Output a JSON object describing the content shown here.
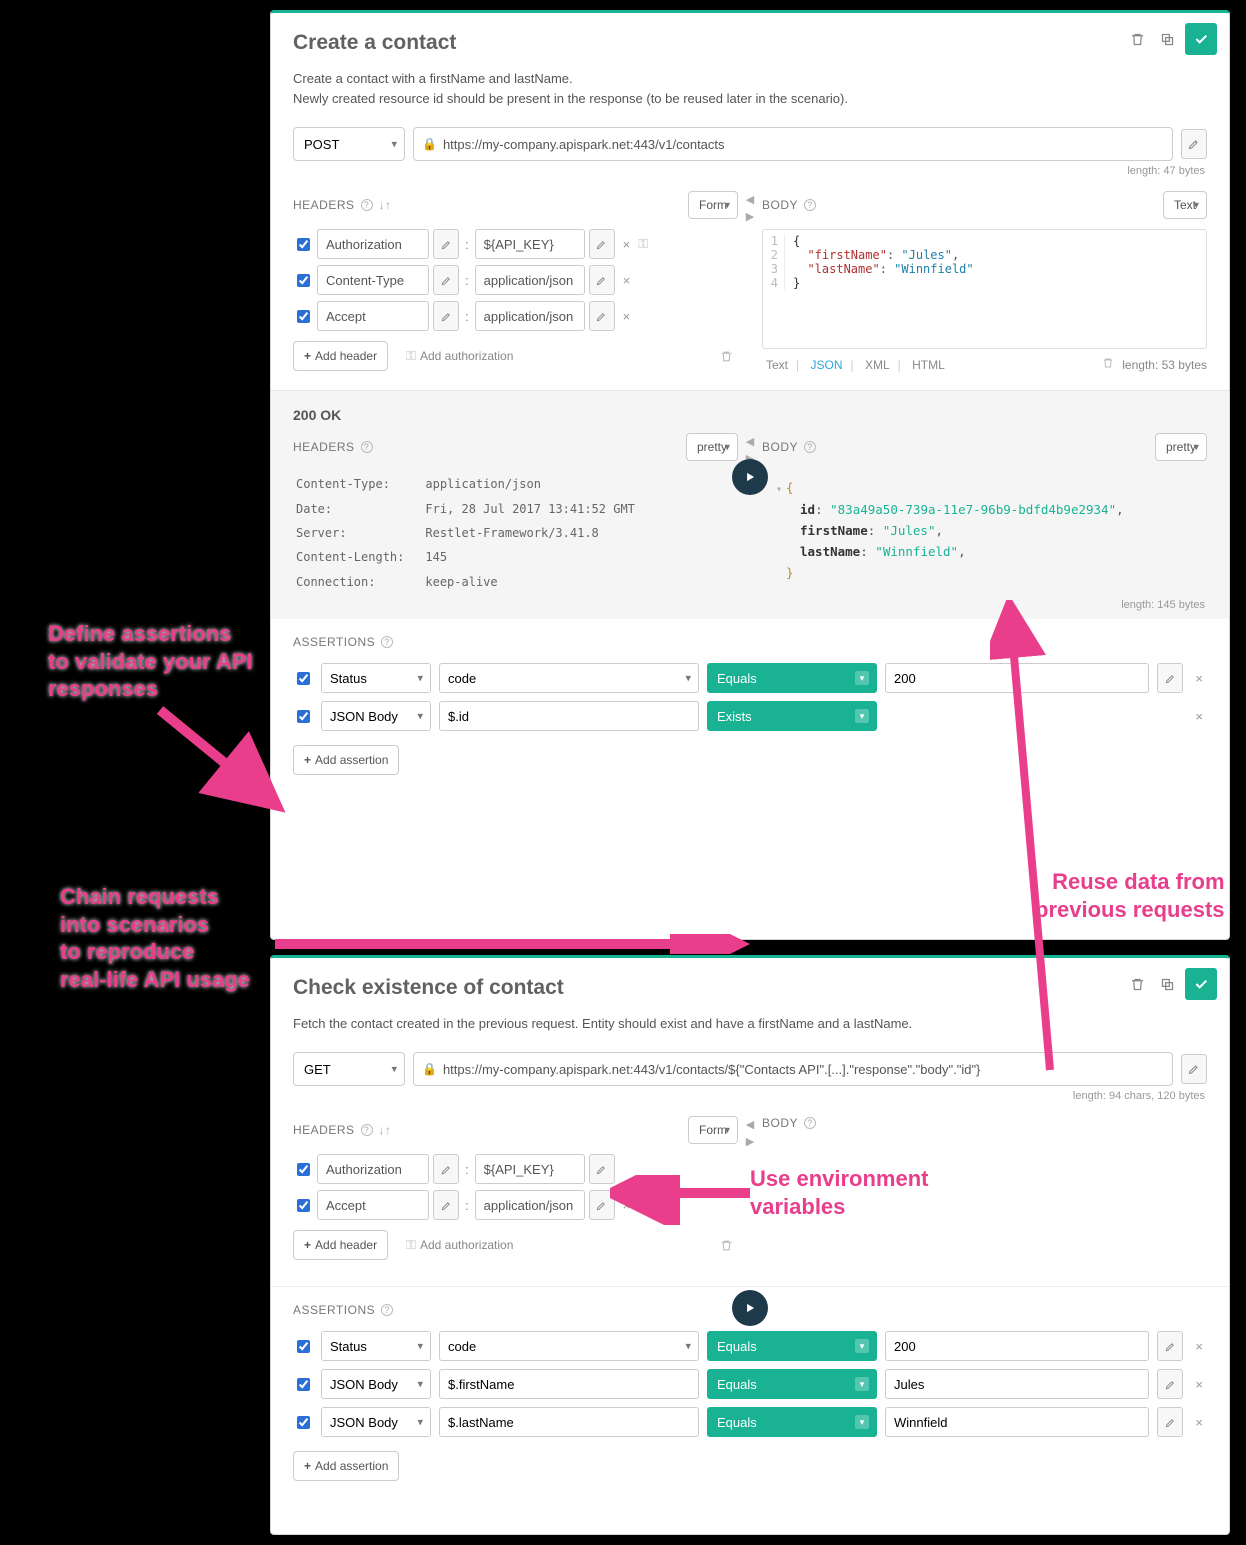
{
  "panel1": {
    "title": "Create a contact",
    "desc1": "Create a contact with a firstName and lastName.",
    "desc2": "Newly created resource id should be present in the response (to be reused later in the scenario).",
    "method": "POST",
    "url": "https://my-company.apispark.net:443/v1/contacts",
    "url_meta": "length: 47 bytes",
    "headers_label": "HEADERS",
    "headers_mode": "Form",
    "body_label": "BODY",
    "body_mode": "Text",
    "headers": [
      {
        "name": "Authorization",
        "value": "${API_KEY}",
        "showKey": true
      },
      {
        "name": "Content-Type",
        "value": "application/json",
        "showKey": false
      },
      {
        "name": "Accept",
        "value": "application/json",
        "showKey": false
      }
    ],
    "add_header": "Add header",
    "add_auth": "Add authorization",
    "body_lines": [
      "{",
      "  \"firstName\": \"Jules\",",
      "  \"lastName\": \"Winnfield\"",
      "}"
    ],
    "body_footer_formats": [
      "Text",
      "JSON",
      "XML",
      "HTML"
    ],
    "body_footer_len": "length: 53 bytes",
    "response": {
      "status": "200 OK",
      "headers_label": "HEADERS",
      "headers_mode": "pretty",
      "body_label": "BODY",
      "body_mode": "pretty",
      "headers": [
        {
          "k": "Content-Type:",
          "v": "application/json"
        },
        {
          "k": "Date:",
          "v": "Fri, 28 Jul 2017 13:41:52 GMT"
        },
        {
          "k": "Server:",
          "v": "Restlet-Framework/3.41.8"
        },
        {
          "k": "Content-Length:",
          "v": "145"
        },
        {
          "k": "Connection:",
          "v": "keep-alive"
        }
      ],
      "body": {
        "id": "83a49a50-739a-11e7-96b9-bdfd4b9e2934",
        "firstName": "Jules",
        "lastName": "Winnfield"
      },
      "body_len": "length: 145 bytes"
    },
    "assertions_label": "ASSERTIONS",
    "assertions": [
      {
        "source": "Status",
        "path": "code",
        "op": "Equals",
        "value": "200"
      },
      {
        "source": "JSON Body",
        "path": "$.id",
        "op": "Exists",
        "value": ""
      }
    ],
    "add_assertion": "Add assertion"
  },
  "panel2": {
    "title": "Check existence of contact",
    "desc": "Fetch the contact created in the previous request. Entity should exist and have a firstName and a lastName.",
    "method": "GET",
    "url": "https://my-company.apispark.net:443/v1/contacts/${\"Contacts API\".[...].\"response\".\"body\".\"id\"}",
    "url_meta": "length: 94 chars, 120 bytes",
    "headers_label": "HEADERS",
    "headers_mode": "Form",
    "body_label": "BODY",
    "headers": [
      {
        "name": "Authorization",
        "value": "${API_KEY}",
        "removable": false
      },
      {
        "name": "Accept",
        "value": "application/json",
        "removable": true
      }
    ],
    "add_header": "Add header",
    "add_auth": "Add authorization",
    "assertions_label": "ASSERTIONS",
    "assertions": [
      {
        "source": "Status",
        "path": "code",
        "op": "Equals",
        "value": "200"
      },
      {
        "source": "JSON Body",
        "path": "$.firstName",
        "op": "Equals",
        "value": "Jules"
      },
      {
        "source": "JSON Body",
        "path": "$.lastName",
        "op": "Equals",
        "value": "Winnfield"
      }
    ],
    "add_assertion": "Add assertion"
  },
  "callouts": {
    "c1": "Define assertions\nto validate your API\nresponses",
    "c2": "Chain requests\ninto scenarios\nto reproduce\nreal-life API usage",
    "c3": "Reuse data from\nprevious requests",
    "c4": "Use environment\nvariables"
  }
}
